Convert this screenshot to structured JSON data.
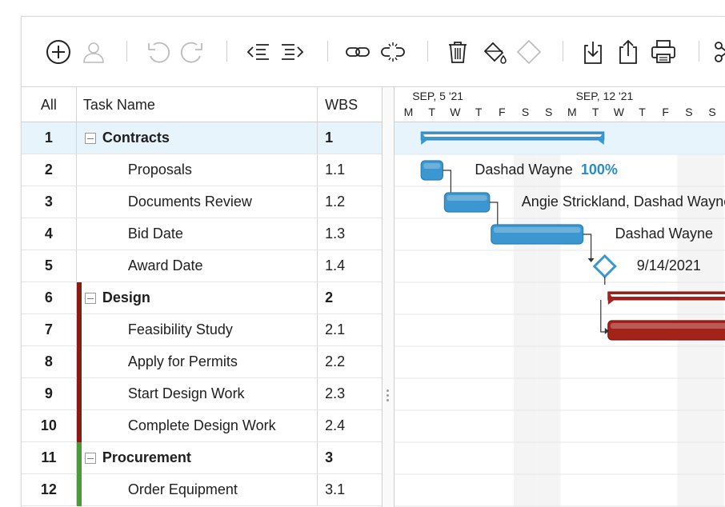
{
  "toolbar": {
    "icons": [
      {
        "name": "add-task-icon",
        "label": "Add"
      },
      {
        "name": "assign-user-icon",
        "label": "Assign"
      },
      {
        "name": "undo-icon",
        "label": "Undo"
      },
      {
        "name": "redo-icon",
        "label": "Redo"
      },
      {
        "name": "outdent-icon",
        "label": "Outdent"
      },
      {
        "name": "indent-icon",
        "label": "Indent"
      },
      {
        "name": "link-icon",
        "label": "Link"
      },
      {
        "name": "unlink-icon",
        "label": "Unlink"
      },
      {
        "name": "delete-icon",
        "label": "Delete"
      },
      {
        "name": "fill-color-icon",
        "label": "Color"
      },
      {
        "name": "milestone-icon",
        "label": "Milestone"
      },
      {
        "name": "import-icon",
        "label": "Import"
      },
      {
        "name": "export-icon",
        "label": "Export"
      },
      {
        "name": "print-icon",
        "label": "Print"
      },
      {
        "name": "cut-icon",
        "label": "Cut"
      }
    ]
  },
  "grid": {
    "headers": {
      "all": "All",
      "name": "Task Name",
      "wbs": "WBS"
    },
    "rows": [
      {
        "num": "1",
        "name": "Contracts",
        "wbs": "1",
        "parent": true,
        "color": "#2b8cc4"
      },
      {
        "num": "2",
        "name": "Proposals",
        "wbs": "1.1",
        "parent": false,
        "color": ""
      },
      {
        "num": "3",
        "name": "Documents Review",
        "wbs": "1.2",
        "parent": false,
        "color": ""
      },
      {
        "num": "4",
        "name": "Bid Date",
        "wbs": "1.3",
        "parent": false,
        "color": ""
      },
      {
        "num": "5",
        "name": "Award Date",
        "wbs": "1.4",
        "parent": false,
        "color": ""
      },
      {
        "num": "6",
        "name": "Design",
        "wbs": "2",
        "parent": true,
        "color": "#8b1a14"
      },
      {
        "num": "7",
        "name": "Feasibility Study",
        "wbs": "2.1",
        "parent": false,
        "color": "#8b1a14"
      },
      {
        "num": "8",
        "name": "Apply for Permits",
        "wbs": "2.2",
        "parent": false,
        "color": "#8b1a14"
      },
      {
        "num": "9",
        "name": "Start Design Work",
        "wbs": "2.3",
        "parent": false,
        "color": "#8b1a14"
      },
      {
        "num": "10",
        "name": "Complete Design Work",
        "wbs": "2.4",
        "parent": false,
        "color": "#8b1a14"
      },
      {
        "num": "11",
        "name": "Procurement",
        "wbs": "3",
        "parent": true,
        "color": "#4a9a3a"
      },
      {
        "num": "12",
        "name": "Order Equipment",
        "wbs": "3.1",
        "parent": false,
        "color": "#4a9a3a"
      }
    ]
  },
  "gantt": {
    "weeks": [
      {
        "label": "SEP, 5 '21",
        "start_day_index": 1
      },
      {
        "label": "SEP, 12 '21",
        "start_day_index": 8
      }
    ],
    "days": [
      "M",
      "T",
      "W",
      "T",
      "F",
      "S",
      "S",
      "M",
      "T",
      "W",
      "T",
      "F",
      "S",
      "S"
    ],
    "weekend_day_indices": [
      5,
      6,
      12,
      13
    ],
    "colors": {
      "blue": "#3a97cf",
      "blue_dark": "#2b7fb3",
      "red": "#a3231a",
      "red_dark": "#7d140f",
      "milestone": "#3a97cf"
    },
    "bars": [
      {
        "row": 0,
        "type": "summary",
        "start": 1.0,
        "end": 9.0,
        "color": "blue"
      },
      {
        "row": 1,
        "type": "task",
        "start": 1.0,
        "end": 2.0,
        "color": "blue",
        "label": "Dashad Wayne",
        "percent": "100%"
      },
      {
        "row": 2,
        "type": "task",
        "start": 2.0,
        "end": 4.0,
        "color": "blue",
        "label": "Angie Strickland, Dashad Wayne"
      },
      {
        "row": 3,
        "type": "task",
        "start": 4.0,
        "end": 8.0,
        "color": "blue",
        "label": "Dashad Wayne"
      },
      {
        "row": 4,
        "type": "milestone",
        "start": 9.0,
        "color": "blue",
        "label": "9/14/2021"
      },
      {
        "row": 5,
        "type": "summary",
        "start": 9.0,
        "end": 15.0,
        "color": "red"
      },
      {
        "row": 6,
        "type": "task",
        "start": 9.0,
        "end": 15.0,
        "color": "red"
      }
    ]
  }
}
